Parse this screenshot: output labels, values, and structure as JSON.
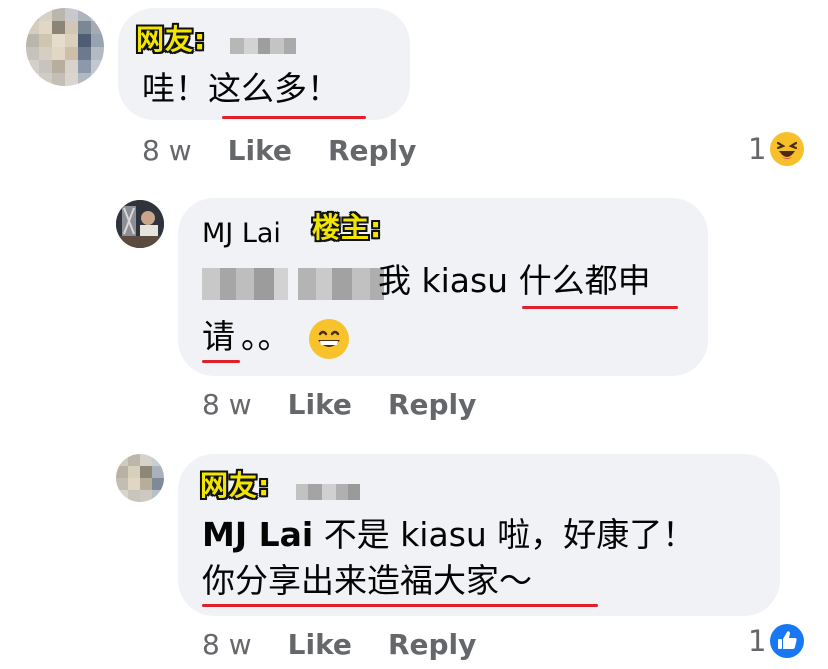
{
  "comments": [
    {
      "tag": "网友:",
      "text_line1_a": "哇！",
      "text_line1_b": "这么多！",
      "age": "8 w",
      "like": "Like",
      "reply": "Reply",
      "reaction_count": "1",
      "reaction_icon": "haha-icon"
    },
    {
      "name": "MJ Lai",
      "tag": "楼主:",
      "text_line1_b": "我 kiasu ",
      "text_line1_c": "什么都申",
      "text_line2_a": "请",
      "text_line2_b": "。。",
      "emoji": "grinning-face-icon",
      "age": "8 w",
      "like": "Like",
      "reply": "Reply"
    },
    {
      "tag": "网友:",
      "mention": "MJ Lai",
      "text_line1": " 不是 kiasu 啦，好康了！",
      "text_line2": "你分享出来造福大家～",
      "age": "8 w",
      "like": "Like",
      "reply": "Reply",
      "reaction_count": "1",
      "reaction_icon": "like-icon"
    }
  ],
  "colors": {
    "bubble": "#f0f2f5",
    "meta": "#65676b",
    "underline": "#e0202a",
    "tag": "#f2e600",
    "like_blue": "#1877f2"
  }
}
